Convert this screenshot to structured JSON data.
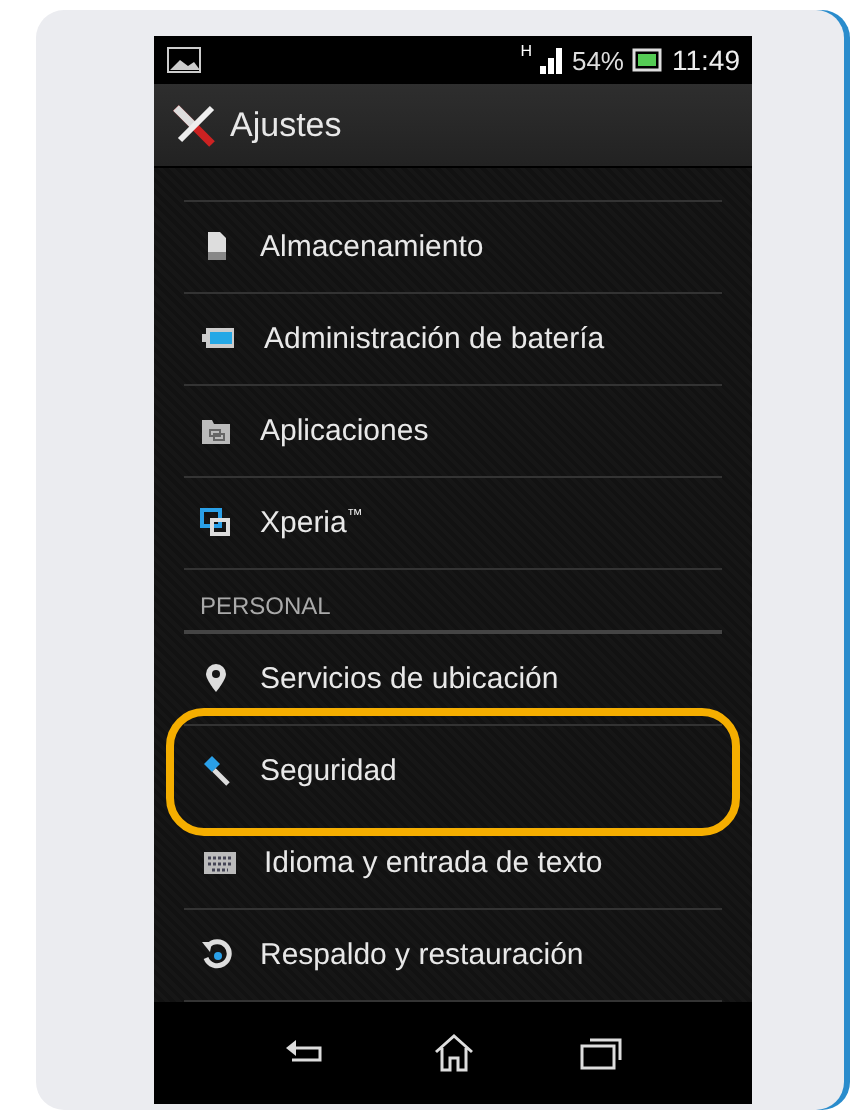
{
  "status_bar": {
    "network": "H",
    "battery": "54%",
    "time": "11:49"
  },
  "action_bar": {
    "title": "Ajustes"
  },
  "list": [
    {
      "kind": "item",
      "label": "Almacenamiento",
      "highlighted": false
    },
    {
      "kind": "item",
      "label": "Administración de batería",
      "highlighted": false
    },
    {
      "kind": "item",
      "label": "Aplicaciones",
      "highlighted": false
    },
    {
      "kind": "item",
      "label": "Xperia$^{™}$",
      "highlighted": false
    },
    {
      "kind": "header",
      "label": "PERSONAL"
    },
    {
      "kind": "item",
      "label": "Servicios de ubicación",
      "highlighted": false
    },
    {
      "kind": "item",
      "label": "Seguridad",
      "highlighted": true
    },
    {
      "kind": "item",
      "label": "Idioma y entrada de texto",
      "highlighted": false
    },
    {
      "kind": "item",
      "label": "Respaldo y restauración",
      "highlighted": false
    }
  ]
}
